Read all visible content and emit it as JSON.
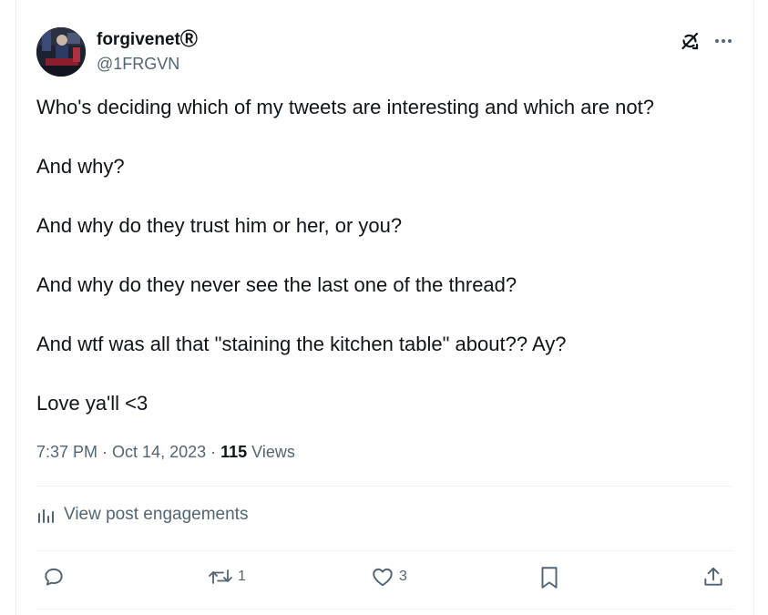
{
  "author": {
    "display_name": "forgivenet",
    "registered_mark": "Ⓡ",
    "handle": "@1FRGVN"
  },
  "tweet": {
    "lines": [
      "Who's deciding which of my tweets are interesting and which are not?",
      "And why?",
      "And why do they trust him or her, or you?",
      "And why do they never see the last one of the thread?",
      "And wtf was all that \"staining the kitchen table\" about?? Ay?",
      "Love ya'll <3"
    ]
  },
  "meta": {
    "time": "7:37 PM",
    "separator": " · ",
    "date": "Oct 14, 2023",
    "views_count": "115",
    "views_label": " Views"
  },
  "engagements": {
    "label": "View post engagements"
  },
  "actions": {
    "reply_count": "",
    "repost_count": "1",
    "like_count": "3"
  },
  "icons": {
    "header": [
      "grok-slash-icon",
      "more-options-icon"
    ],
    "actions": [
      "reply-icon",
      "repost-icon",
      "like-icon",
      "bookmark-icon",
      "share-icon"
    ],
    "engagements": "analytics-icon"
  },
  "colors": {
    "text_primary": "#0f1419",
    "text_secondary": "#536471",
    "divider": "#eff3f4"
  }
}
